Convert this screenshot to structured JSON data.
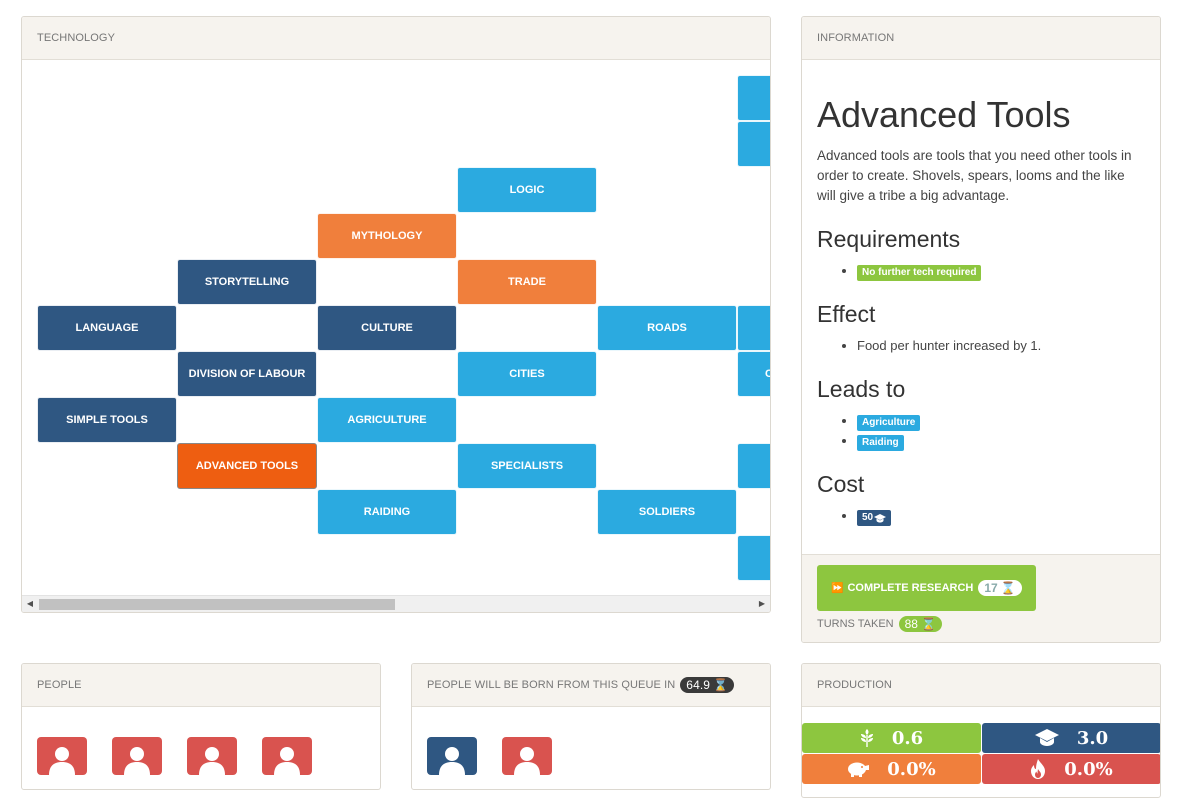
{
  "technology": {
    "header": "TECHNOLOGY",
    "nodes": {
      "logic": "LOGIC",
      "mythology": "MYTHOLOGY",
      "storytelling": "STORYTELLING",
      "trade": "TRADE",
      "language": "LANGUAGE",
      "culture": "CULTURE",
      "roads": "ROADS",
      "division_of_labour": "DIVISION OF LABOUR",
      "cities": "CITIES",
      "cities_partial": "C",
      "simple_tools": "SIMPLE TOOLS",
      "agriculture": "AGRICULTURE",
      "advanced_tools": "ADVANCED TOOLS",
      "specialists": "SPECIALISTS",
      "raiding": "RAIDING",
      "soldiers": "SOLDIERS"
    }
  },
  "information": {
    "header": "INFORMATION",
    "title": "Advanced Tools",
    "description": "Advanced tools are tools that you need other tools in order to create. Shovels, spears, looms and the like will give a tribe a big advantage.",
    "requirements_heading": "Requirements",
    "requirements": [
      "No further tech required"
    ],
    "effect_heading": "Effect",
    "effects": [
      "Food per hunter increased by 1."
    ],
    "leads_to_heading": "Leads to",
    "leads_to": [
      "Agriculture",
      "Raiding"
    ],
    "cost_heading": "Cost",
    "cost": "50",
    "complete_research_label": "COMPLETE RESEARCH",
    "complete_research_turns": "17",
    "turns_taken_label": "TURNS TAKEN",
    "turns_taken": "88"
  },
  "people": {
    "header": "PEOPLE",
    "count": 4
  },
  "queue": {
    "header": "PEOPLE WILL BE BORN FROM THIS QUEUE IN",
    "time": "64.9"
  },
  "production": {
    "header": "PRODUCTION",
    "food": "0.6",
    "science": "3.0",
    "savings": "0.0%",
    "fire": "0.0%",
    "colors": {
      "food": "#8dc63f",
      "science": "#2f5782",
      "savings": "#f07f3c",
      "fire": "#d9534f"
    }
  }
}
